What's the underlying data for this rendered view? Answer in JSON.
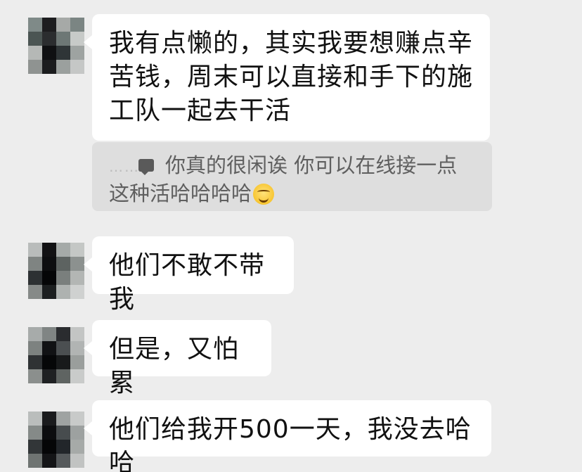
{
  "messages": [
    {
      "text": "我有点懒的，其实我要想赚点辛苦钱，周末可以直接和手下的施工队一起去干活"
    },
    {
      "text": "他们不敢不带我"
    },
    {
      "text": "但是，又怕累"
    },
    {
      "text": "他们给我开500一天，我没去哈哈"
    }
  ],
  "quote": {
    "sender_placeholder": "……",
    "text": "你真的很闲诶 你可以在线接一点这种活哈哈哈哈",
    "emoji": "grinning-face-emoji"
  },
  "colors": {
    "background": "#ededed",
    "bubble": "#ffffff",
    "quote_background": "#dedede",
    "quote_text": "#5f5f5f"
  }
}
